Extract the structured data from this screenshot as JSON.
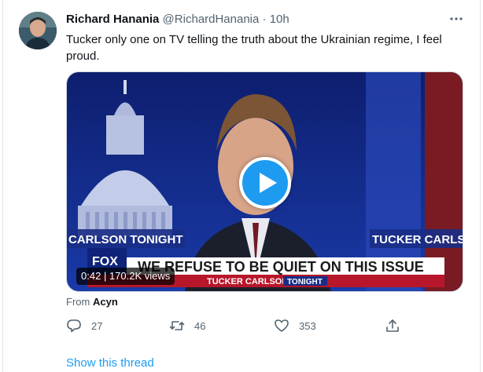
{
  "tweet": {
    "author_name": "Richard Hanania",
    "author_handle": "@RichardHanania",
    "time_ago": "10h",
    "text": "Tucker only one on TV telling the truth about the Ukrainian regime, I  feel proud.",
    "more_icon": "more-horizontal-icon"
  },
  "video": {
    "duration": "0:42",
    "views": "170.2K views",
    "chyron_headline": "WE REFUSE TO BE QUIET ON THIS ISSUE",
    "chyron_show": "TUCKER CARLSON",
    "chyron_show_suffix": "TONIGHT",
    "banner_left": "CARLSON TONIGHT",
    "banner_right": "TUCKER CARLSO",
    "network_logo": "FOX"
  },
  "attribution": {
    "prefix": "From",
    "source": "Acyn"
  },
  "actions": {
    "reply_count": "27",
    "retweet_count": "46",
    "like_count": "353"
  },
  "show_thread": "Show this thread",
  "colors": {
    "accent": "#1d9bf0",
    "text": "#0f1419",
    "secondary": "#536471"
  }
}
